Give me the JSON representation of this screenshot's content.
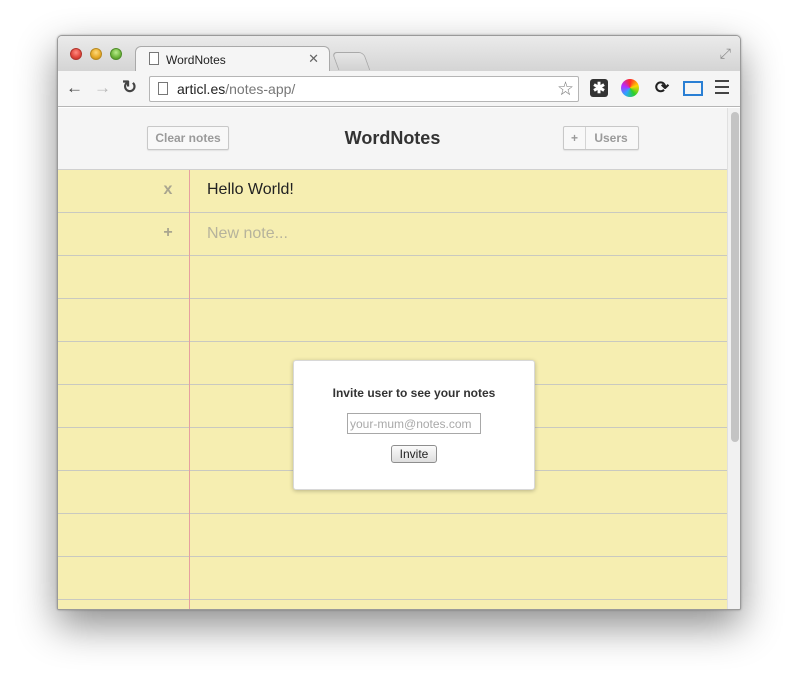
{
  "browser": {
    "tab": {
      "title": "WordNotes",
      "close_glyph": "✕"
    },
    "url": {
      "domain": "articl.es",
      "path": "/notes-app/"
    },
    "icons": [
      "back-arrow-icon",
      "forward-arrow-icon",
      "reload-icon",
      "star-icon",
      "asterisk-extension-icon",
      "color-wheel-extension-icon",
      "sync-extension-icon",
      "screen-capture-extension-icon",
      "menu-icon"
    ]
  },
  "app": {
    "title": "WordNotes",
    "clear_button": "Clear notes",
    "users_button": {
      "plus": "+",
      "label": "Users"
    },
    "notes": [
      {
        "action": "x",
        "text": "Hello World!"
      }
    ],
    "new_note": {
      "action": "+",
      "placeholder": "New note..."
    }
  },
  "invite_modal": {
    "title": "Invite user to see your notes",
    "email_placeholder": "your-mum@notes.com",
    "button": "Invite"
  },
  "colors": {
    "paper": "#f6eeb1",
    "margin_line": "#e6a0a0",
    "ruled_line": "#c9c9c0",
    "header_bg": "#f5f5f5"
  }
}
